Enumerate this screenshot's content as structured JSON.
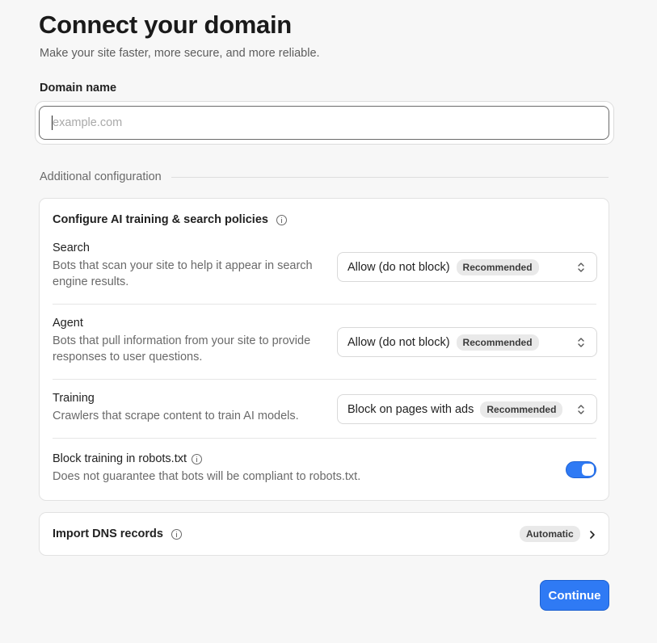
{
  "header": {
    "title": "Connect your domain",
    "subtitle": "Make your site faster, more secure, and more reliable."
  },
  "domain": {
    "label": "Domain name",
    "value": "",
    "placeholder": "example.com"
  },
  "additional": {
    "heading": "Additional configuration"
  },
  "ai_policies": {
    "title": "Configure AI training & search policies",
    "info_icon": "info-icon",
    "rows": [
      {
        "title": "Search",
        "description": "Bots that scan your site to help it appear in search engine results.",
        "selected": "Allow (do not block)",
        "badge": "Recommended"
      },
      {
        "title": "Agent",
        "description": "Bots that pull information from your site to provide responses to user questions.",
        "selected": "Allow (do not block)",
        "badge": "Recommended"
      },
      {
        "title": "Training",
        "description": "Crawlers that scrape content to train AI models.",
        "selected": "Block on pages with ads",
        "badge": "Recommended"
      }
    ],
    "robots": {
      "title": "Block training in robots.txt",
      "description": "Does not guarantee that bots will be compliant to robots.txt.",
      "enabled": true
    }
  },
  "dns": {
    "title": "Import DNS records",
    "badge": "Automatic"
  },
  "actions": {
    "continue_label": "Continue"
  },
  "colors": {
    "accent": "#2f7af4",
    "background": "#f7f7f7"
  }
}
